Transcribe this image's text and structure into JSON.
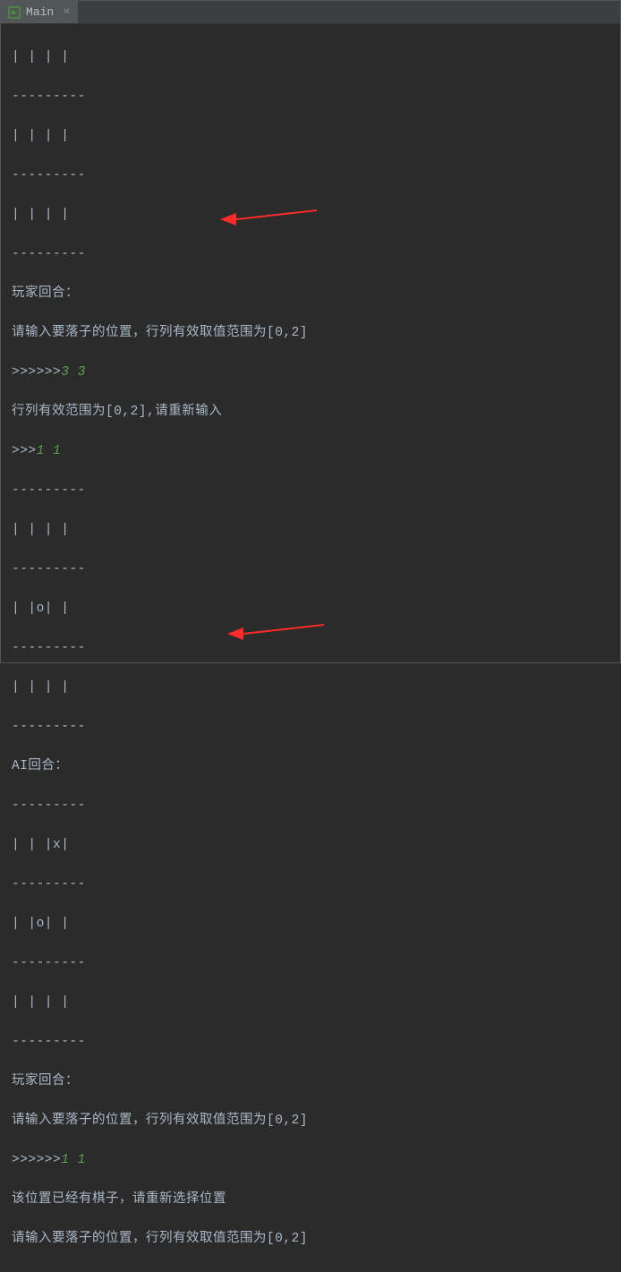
{
  "tab": {
    "title": "Main",
    "close_glyph": "×"
  },
  "lines": {
    "l0": "| | | |",
    "l1": "---------",
    "l2": "| | | |",
    "l3": "---------",
    "l4": "| | | |",
    "l5": "---------",
    "l6": "玩家回合：",
    "l7": "请输入要落子的位置，行列有效取值范围为[0,2]",
    "l8_prompt": ">>>>>>",
    "l8_input": "3 3",
    "l9": "行列有效范围为[0,2],请重新输入",
    "l10_prompt": ">>>",
    "l10_input": "1 1",
    "l11": "---------",
    "l12": "| | | |",
    "l13": "---------",
    "l14": "| |o| |",
    "l15": "---------",
    "l16": "| | | |",
    "l17": "---------",
    "l18": "AI回合：",
    "l19": "---------",
    "l20": "| | |x|",
    "l21": "---------",
    "l22": "| |o| |",
    "l23": "---------",
    "l24": "| | | |",
    "l25": "---------",
    "l26": "玩家回合：",
    "l27": "请输入要落子的位置，行列有效取值范围为[0,2]",
    "l28_prompt": ">>>>>>",
    "l28_input": "1 1",
    "l29": "该位置已经有棋子，请重新选择位置",
    "l30": "请输入要落子的位置，行列有效取值范围为[0,2]"
  }
}
